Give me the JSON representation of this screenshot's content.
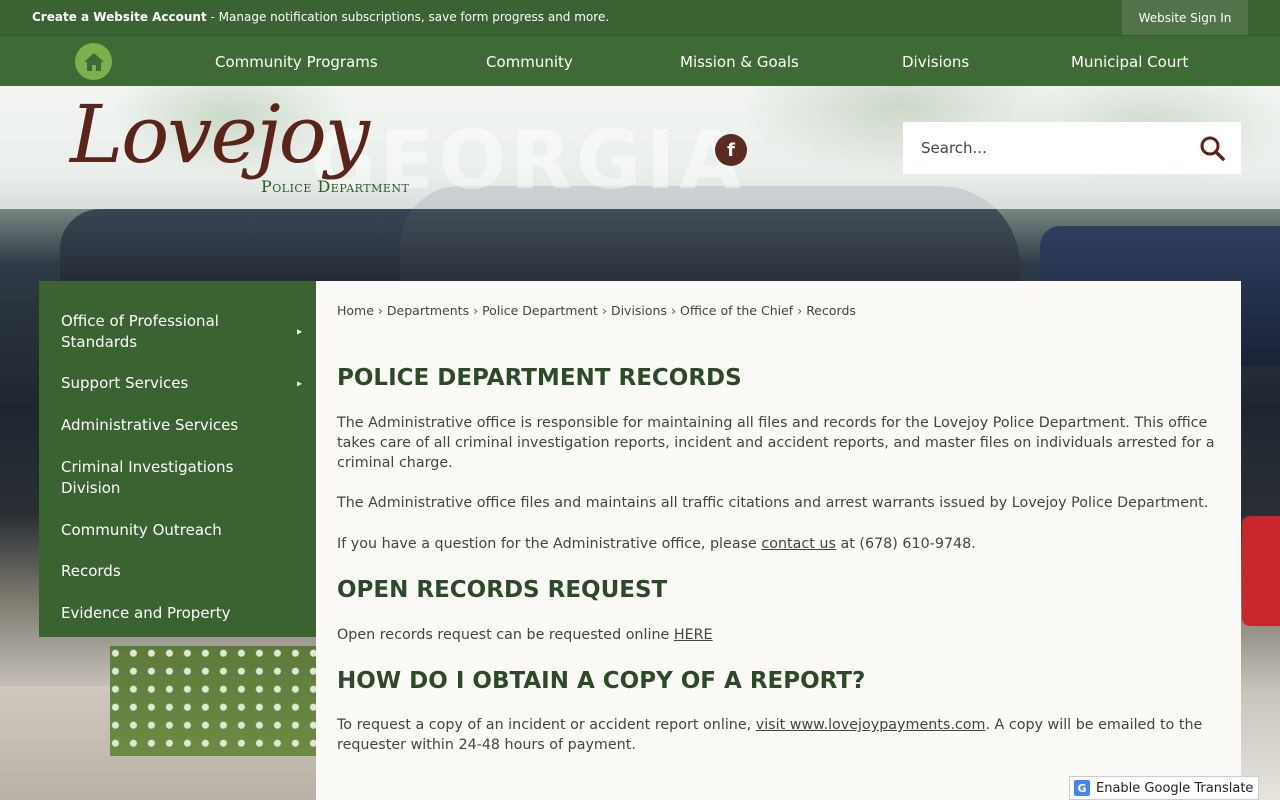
{
  "topbar": {
    "account_link": "Create a Website Account",
    "account_text": " - Manage notification subscriptions, save form progress and more.",
    "signin": "Website Sign In"
  },
  "nav": {
    "items": [
      "Community Programs",
      "Community",
      "Mission & Goals",
      "Divisions",
      "Municipal Court"
    ]
  },
  "header": {
    "logo_script": "Lovejoy",
    "logo_sub": "Police Department",
    "watermark": "GEORGIA",
    "facebook": "f"
  },
  "search": {
    "placeholder": "Search..."
  },
  "sidebar": {
    "items": [
      "Office of Professional Standards",
      "Support Services",
      "Administrative Services",
      "Criminal Investigations Division",
      "Community Outreach",
      "Records",
      "Evidence and Property"
    ],
    "arrow": "▸"
  },
  "breadcrumb": [
    "Home",
    "Departments",
    "Police Department",
    "Divisions",
    "Office of the Chief",
    "Records"
  ],
  "content": {
    "h1": "POLICE DEPARTMENT RECORDS",
    "p1": "The Administrative office is responsible for maintaining all files and records for the Lovejoy Police Department. This office takes care of all criminal investigation reports, incident and accident reports, and master files on individuals arrested for a criminal charge.",
    "p2": "The Administrative office files and maintains all traffic citations and arrest warrants issued by Lovejoy Police Department.",
    "p3_pre": "If you have a question for the Administrative office, please ",
    "p3_link": "contact us",
    "p3_post": " at (678) 610-9748.",
    "h2a": "OPEN RECORDS REQUEST",
    "p4_pre": "Open records request can be requested online ",
    "p4_link": "HERE",
    "h2b": "HOW DO I OBTAIN A COPY OF A REPORT?",
    "p5_pre": "To request a copy of an incident or accident report online, ",
    "p5_link": "visit www.lovejoypayments.com",
    "p5_post": ". A copy will be emailed to the requester within 24-48 hours of payment."
  },
  "translate": {
    "label": "Enable Google Translate",
    "icon": "G"
  },
  "colors": {
    "primary_green": "#3b6232",
    "home_green": "#7bb04c",
    "logo_brown": "#5a2418",
    "heading": "#2d4a28"
  }
}
